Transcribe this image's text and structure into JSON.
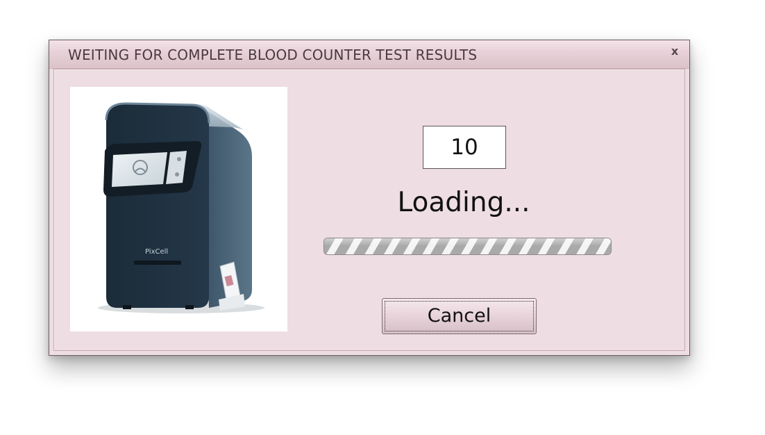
{
  "window": {
    "title": "WEITING FOR COMPLETE BLOOD COUNTER TEST RESULTS",
    "close_label": "x"
  },
  "device_image": {
    "brand_label": "PixCell",
    "icon": "blood-analyzer-device-image"
  },
  "countdown": {
    "value": "10"
  },
  "status": {
    "text": "Loading..."
  },
  "progress": {
    "mode": "indeterminate",
    "fill_percent": 100
  },
  "buttons": {
    "cancel_label": "Cancel"
  },
  "colors": {
    "dialog_background": "#eedde2",
    "titlebar": "#e7d0d7",
    "button": "#e6d1d8"
  }
}
